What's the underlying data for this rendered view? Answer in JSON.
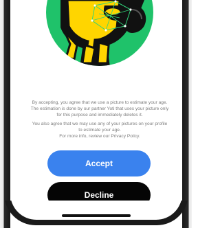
{
  "illustration": {
    "icon": "mascot-avatar-icon",
    "colors": {
      "circle": "#1fc26a",
      "outline": "#111111",
      "accent": "#ffd500"
    }
  },
  "consent": {
    "paragraph_1": "By accepting, you agree that we use a picture to estimate your age. The estimation is done by our partner Yoti that uses your picture only for this purpose and immediately deletes it.",
    "paragraph_2_line_1": "You also agree that we may use any of your pictures on your profile to estimate your age.",
    "paragraph_2_line_2": "For more info, review our Privacy Policy."
  },
  "actions": {
    "accept_label": "Accept",
    "decline_label": "Decline",
    "colors": {
      "accept": "#3a82ee",
      "decline": "#050505"
    }
  }
}
